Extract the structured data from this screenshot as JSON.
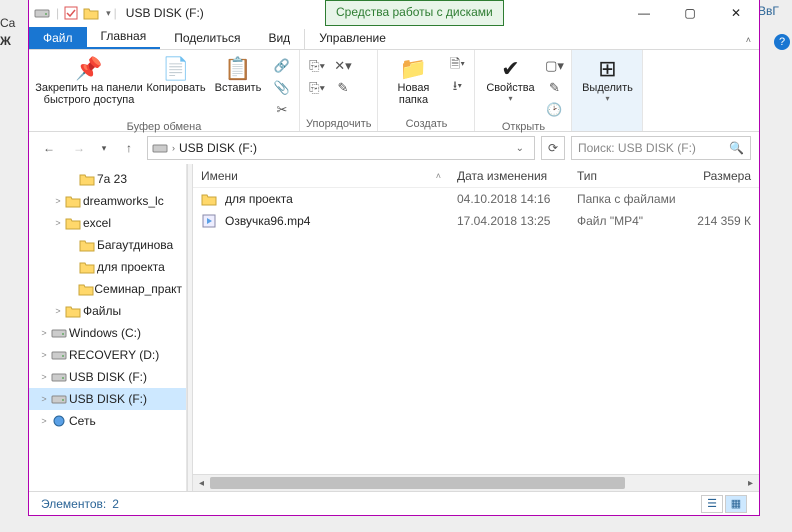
{
  "behind": {
    "left1": "Ca",
    "left2": "Ж",
    "right": "ВвГ"
  },
  "title": "USB DISK (F:)",
  "context_tab": "Средства работы с дисками",
  "tabs": {
    "file": "Файл",
    "main": "Главная",
    "share": "Поделиться",
    "view": "Вид",
    "manage": "Управление"
  },
  "ribbon": {
    "pin": "Закрепить на панели\nбыстрого доступа",
    "copy": "Копировать",
    "paste": "Вставить",
    "group_clipboard": "Буфер обмена",
    "group_organize": "Упорядочить",
    "new_folder": "Новая\nпапка",
    "group_create": "Создать",
    "properties": "Свойства",
    "group_open": "Открыть",
    "select": "Выделить"
  },
  "address": {
    "drive": "USB DISK (F:)"
  },
  "search_placeholder": "Поиск: USB DISK (F:)",
  "tree": [
    {
      "depth": 3,
      "exp": "",
      "icon": "folder",
      "label": "7а 23"
    },
    {
      "depth": 2,
      "exp": ">",
      "icon": "folder",
      "label": "dreamworks_lc"
    },
    {
      "depth": 2,
      "exp": ">",
      "icon": "folder",
      "label": "excel"
    },
    {
      "depth": 3,
      "exp": "",
      "icon": "folder",
      "label": "Багаутдинова"
    },
    {
      "depth": 3,
      "exp": "",
      "icon": "folder",
      "label": "для проекта"
    },
    {
      "depth": 3,
      "exp": "",
      "icon": "folder",
      "label": "Семинар_практ"
    },
    {
      "depth": 2,
      "exp": ">",
      "icon": "folder",
      "label": "Файлы"
    },
    {
      "depth": 1,
      "exp": ">",
      "icon": "drive",
      "label": "Windows (C:)"
    },
    {
      "depth": 1,
      "exp": ">",
      "icon": "drive",
      "label": "RECOVERY (D:)"
    },
    {
      "depth": 1,
      "exp": ">",
      "icon": "drive",
      "label": "USB DISK (F:)"
    },
    {
      "depth": 1,
      "exp": ">",
      "icon": "drive",
      "label": "USB DISK (F:)",
      "selected": true
    },
    {
      "depth": 1,
      "exp": ">",
      "icon": "net",
      "label": "Сеть"
    }
  ],
  "columns": {
    "name": "Имени",
    "date": "Дата изменения",
    "type": "Тип",
    "size": "Размера"
  },
  "rows": [
    {
      "icon": "folder",
      "name": "для проекта",
      "date": "04.10.2018 14:16",
      "type": "Папка с файлами",
      "size": ""
    },
    {
      "icon": "video",
      "name": "Озвучка96.mp4",
      "date": "17.04.2018 13:25",
      "type": "Файл \"MP4\"",
      "size": "214 359 К"
    }
  ],
  "status": {
    "label": "Элементов:",
    "count": "2"
  }
}
